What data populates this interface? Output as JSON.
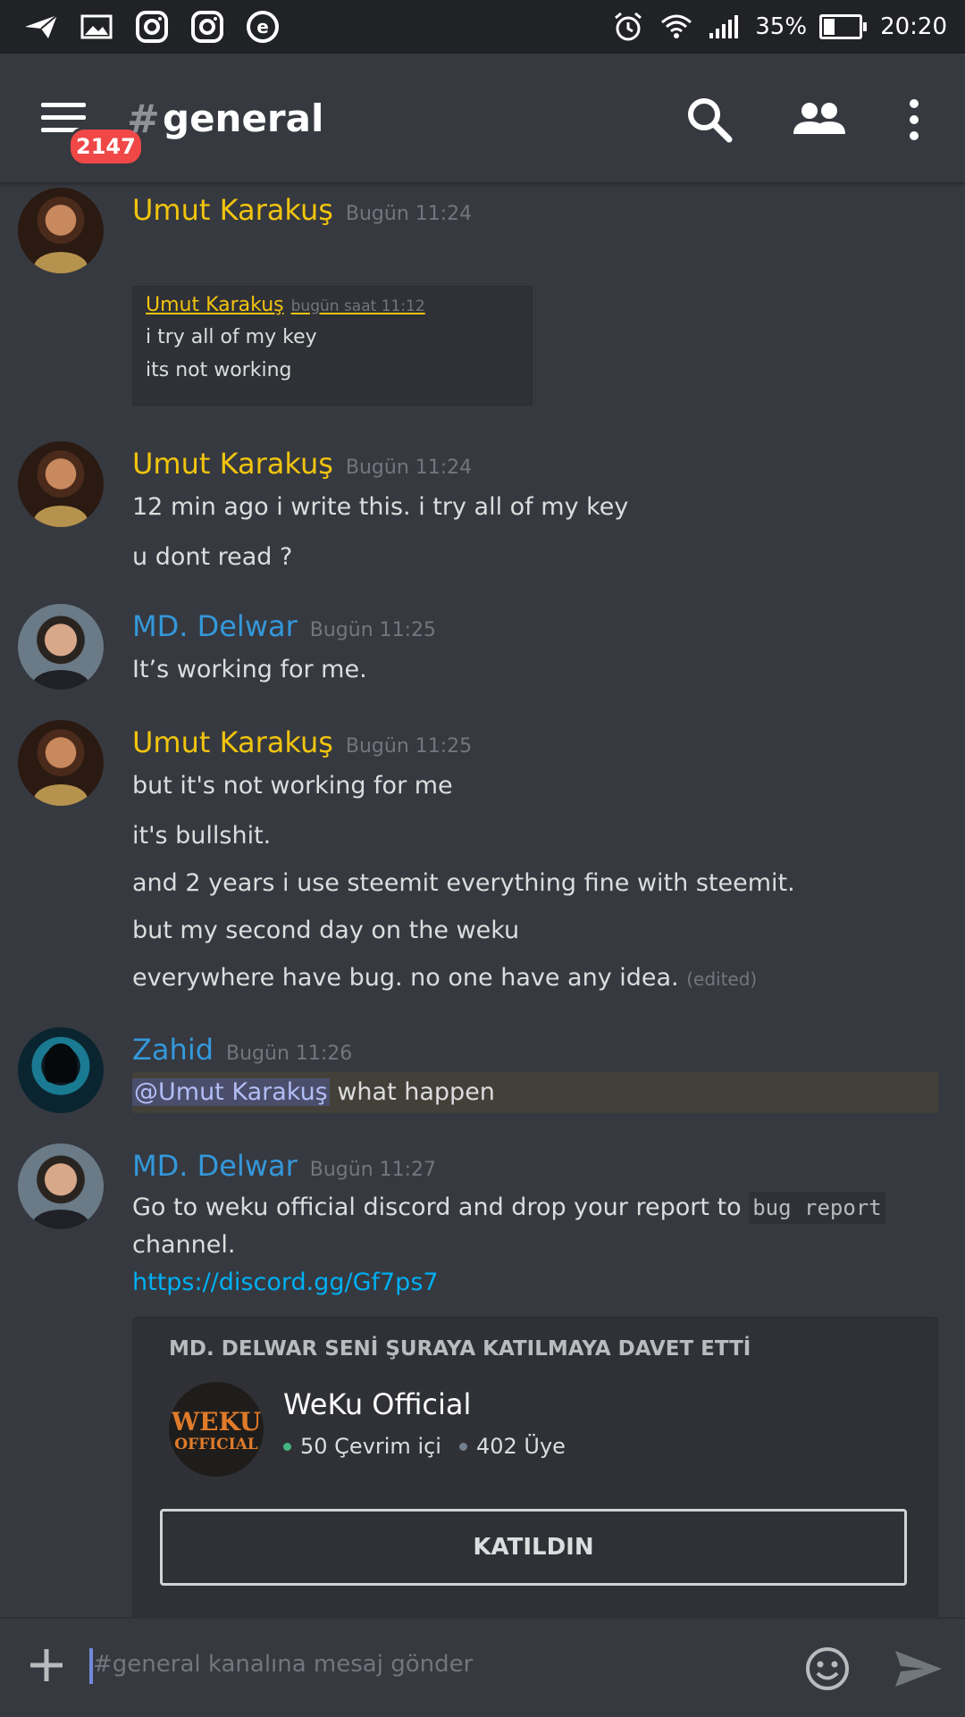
{
  "status_bar": {
    "battery_percent": "35%",
    "battery_level": 0.35,
    "time": "20:20"
  },
  "header": {
    "unread_badge": "2147",
    "hash": "#",
    "channel": "general"
  },
  "messages": [
    {
      "author": "Umut Karakuş",
      "timestamp": "Bugün 11:24",
      "quote": {
        "author": "Umut Karakuş",
        "time": "bugün saat 11:12",
        "lines": [
          "i try all of my key",
          "its not working"
        ]
      }
    },
    {
      "author": "Umut Karakuş",
      "timestamp": "Bugün 11:24",
      "lines": [
        "12 min ago i write this. i try all of my key",
        "u dont read ?"
      ]
    },
    {
      "author": "MD. Delwar",
      "timestamp": "Bugün 11:25",
      "lines": [
        "It’s working for me."
      ]
    },
    {
      "author": "Umut Karakuş",
      "timestamp": "Bugün 11:25",
      "lines": [
        "but it's not working for me",
        "it's bullshit.",
        "and 2 years i use steemit everything fine with steemit.",
        "but my second day on the weku",
        "everywhere have bug. no one have any idea."
      ],
      "edited": "(edited)"
    },
    {
      "author": "Zahid",
      "timestamp": "Bugün 11:26",
      "mention": "@Umut Karakuş",
      "text": " what happen"
    },
    {
      "author": "MD. Delwar",
      "timestamp": "Bugün 11:27",
      "line1": "Go to weku official discord and drop your report to ",
      "code": "bug report",
      "line2": "channel.",
      "link": "https://discord.gg/Gf7ps7",
      "invite": {
        "heading": "MD. DELWAR SENİ ŞURAYA KATILMAYA DAVET ETTİ",
        "logo_line1": "WEKU",
        "logo_line2": "OFFICIAL",
        "server_name": "WeKu Official",
        "online": "50 Çevrim içi",
        "members": "402 Üye",
        "button": "KATILDIN"
      }
    }
  ],
  "composer": {
    "placeholder": "#general kanalına mesaj gönder"
  },
  "colors": {
    "background": "#36393f",
    "status_bar": "#202225",
    "username_yellow": "#f1c40f",
    "username_blue": "#3498db",
    "link": "#00b0f4",
    "badge": "#f04747",
    "online_dot": "#43b581"
  },
  "icons": {
    "status_left": [
      "send-icon",
      "image-icon",
      "instagram-icon",
      "instagram-icon",
      "e-icon"
    ],
    "status_right": [
      "alarm-icon",
      "wifi-icon",
      "signal-icon",
      "battery-icon"
    ],
    "header": [
      "menu-icon",
      "search-icon",
      "members-icon",
      "more-vertical-icon"
    ],
    "composer": [
      "plus-icon",
      "emoji-icon",
      "send-arrow-icon"
    ]
  }
}
